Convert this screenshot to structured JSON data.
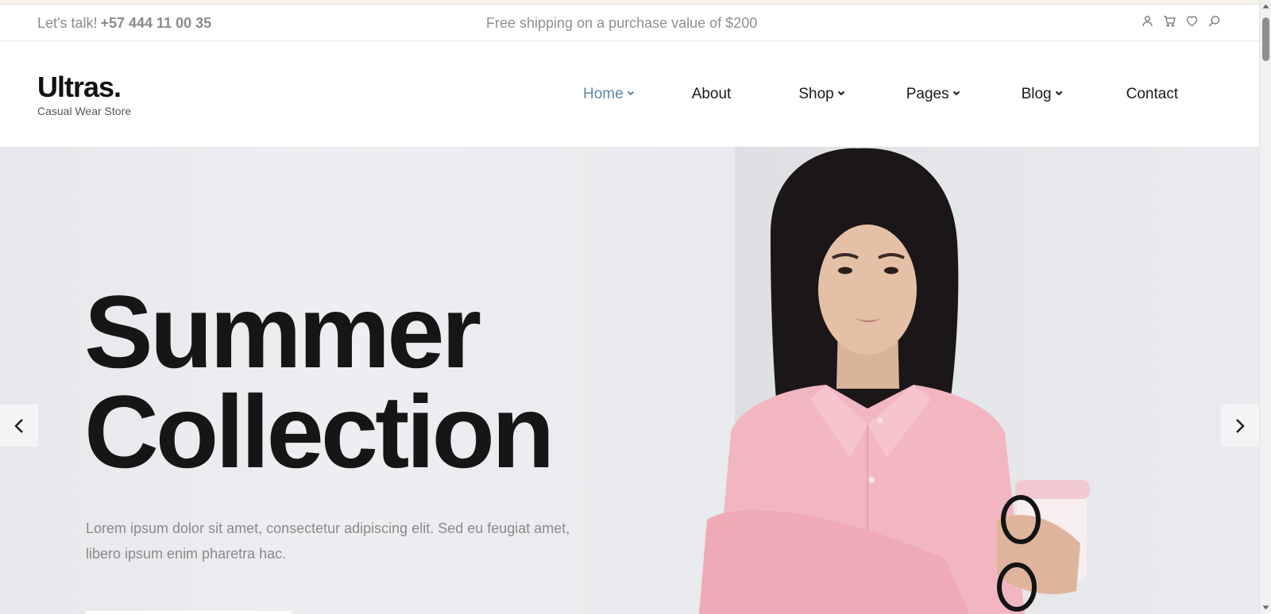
{
  "topbar": {
    "talk_label": "Let's talk!",
    "phone": "+57 444 11 00 35",
    "promo": "Free shipping on a purchase value of $200",
    "icons": [
      "user-icon",
      "cart-icon",
      "heart-icon",
      "search-icon"
    ]
  },
  "header": {
    "brand": "Ultras.",
    "tagline": "Casual Wear Store",
    "nav": [
      {
        "label": "Home",
        "has_dropdown": true,
        "active": true
      },
      {
        "label": "About",
        "has_dropdown": false,
        "active": false
      },
      {
        "label": "Shop",
        "has_dropdown": true,
        "active": false
      },
      {
        "label": "Pages",
        "has_dropdown": true,
        "active": false
      },
      {
        "label": "Blog",
        "has_dropdown": true,
        "active": false
      },
      {
        "label": "Contact",
        "has_dropdown": false,
        "active": false
      }
    ]
  },
  "hero": {
    "title_line1": "Summer",
    "title_line2": "Collection",
    "description_line1": "Lorem ipsum dolor sit amet, consectetur adipiscing elit. Sed eu feugiat amet,",
    "description_line2": "libero ipsum enim pharetra hac.",
    "prev_icon": "chevron-left-icon",
    "next_icon": "chevron-right-icon"
  },
  "colors": {
    "accent_nav": "#5b86a8",
    "text_dark": "#161616",
    "text_muted": "#8a8a8a",
    "hero_bg": "#e9ebee",
    "shirt_pink": "#f2b6c0"
  }
}
